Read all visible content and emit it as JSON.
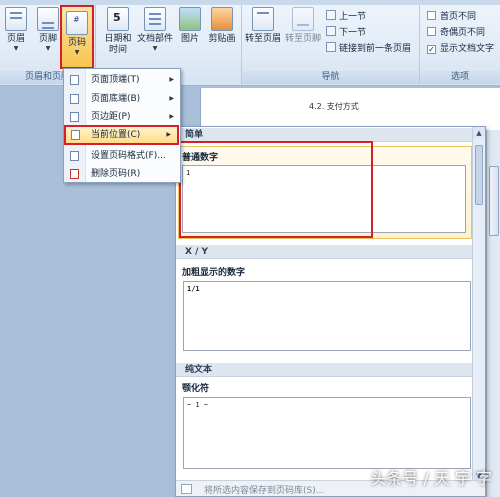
{
  "ribbon": {
    "groups": {
      "header_footer": "页眉和页脚",
      "navigation": "导航",
      "options": "选项"
    },
    "buttons": {
      "header": "页眉",
      "footer": "页脚",
      "page_number": "页码",
      "date_time_line1": "日期和",
      "date_time_line2": "时间",
      "doc_parts": "文档部件",
      "picture": "图片",
      "clip_art": "剪贴画",
      "goto_header": "转至页眉",
      "goto_footer": "转至页脚",
      "prev_section": "上一节",
      "next_section": "下一节",
      "link_to_previous": "链接到前一条页眉"
    },
    "options": {
      "first_page_diff": "首页不同",
      "odd_even_diff": "奇偶页不同",
      "show_doc_text": "显示文档文字",
      "show_doc_text_checked": "✓"
    }
  },
  "menu": {
    "items": [
      {
        "label": "页面顶端(T)",
        "submenu": "▶"
      },
      {
        "label": "页面底端(B)",
        "submenu": "▶"
      },
      {
        "label": "页边距(P)",
        "submenu": "▶"
      },
      {
        "label": "当前位置(C)",
        "submenu": "▶"
      },
      {
        "label": "设置页码格式(F)..."
      },
      {
        "label": "删除页码(R)"
      }
    ]
  },
  "gallery": {
    "categories": {
      "simple": "简单",
      "xy": "X / Y",
      "plain_text": "纯文本"
    },
    "items": {
      "plain_number": {
        "title": "普通数字",
        "preview": "1"
      },
      "bold_number": {
        "title": "加粗显示的数字",
        "preview": "1/1"
      },
      "tilde": {
        "title": "颚化符",
        "preview": "~ 1 ~"
      }
    },
    "footer": "将所选内容保存到页码库(S)..."
  },
  "document": {
    "heading": "4.2. 支付方式"
  },
  "watermark": "头条号 / 天 宇 字"
}
